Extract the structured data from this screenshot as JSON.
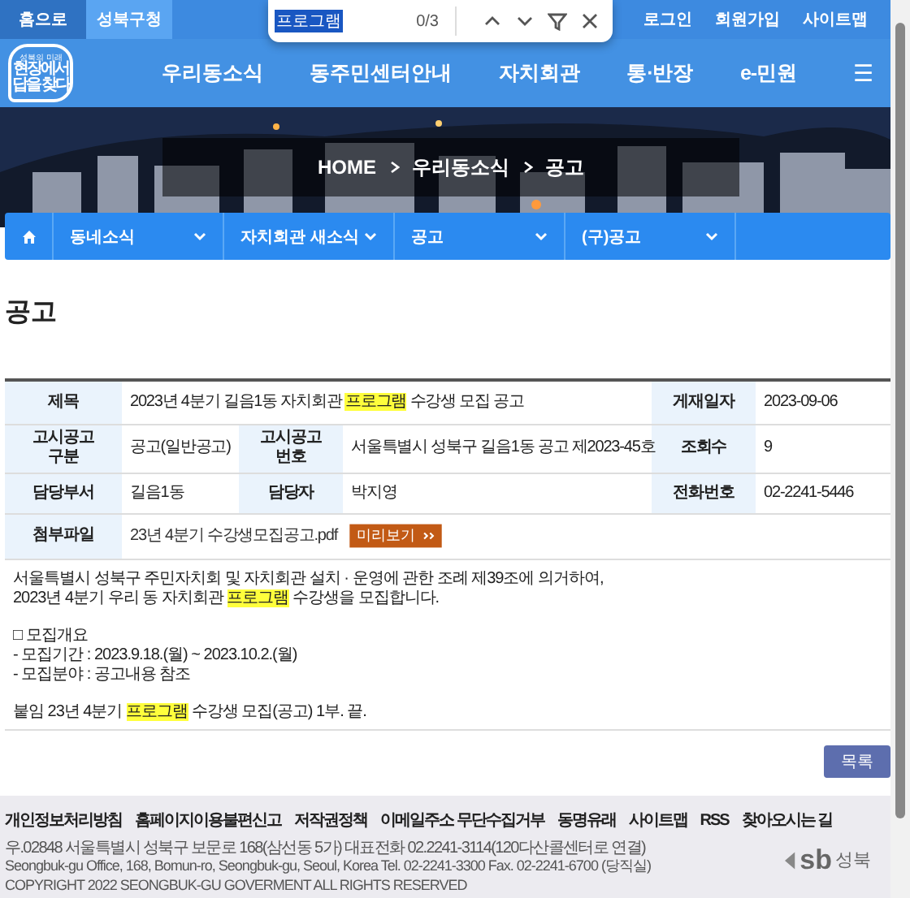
{
  "top_bar": {
    "tabs": [
      {
        "label": "홈으로",
        "selected": true
      },
      {
        "label": "성북구청",
        "selected": false
      }
    ],
    "user_links": [
      "로그인",
      "회원가입",
      "사이트맵"
    ]
  },
  "find_bar": {
    "value": "프로그램",
    "count": "0/3"
  },
  "header": {
    "logo": {
      "tagline": "성북의 미래",
      "lines": [
        "현장에서",
        "답을 찾다"
      ]
    },
    "menu": [
      "우리동소식",
      "동주민센터안내",
      "자치회관",
      "통·반장",
      "e-민원"
    ],
    "menu_icon": "☰"
  },
  "breadcrumb": [
    "HOME",
    "우리동소식",
    "공고"
  ],
  "sub_nav": [
    "동네소식",
    "자치회관 새소식",
    "공고",
    "(구)공고"
  ],
  "page_title": "공고",
  "notice": {
    "rows": [
      {
        "cells": [
          {
            "kind": "label",
            "text": "제목"
          },
          {
            "kind": "value",
            "colspan": 3,
            "segments": [
              {
                "text": "2023년 4분기 길음1동 자치회관 ",
                "highlighted": false
              },
              {
                "text": "프로그램",
                "highlighted": true
              },
              {
                "text": " 수강생 모집 공고",
                "highlighted": false
              }
            ]
          },
          {
            "kind": "label",
            "text": "게재일자"
          },
          {
            "kind": "value",
            "text": "2023-09-06"
          }
        ]
      },
      {
        "cells": [
          {
            "kind": "label",
            "text": "고시공고 구분"
          },
          {
            "kind": "value",
            "text": "공고(일반공고)"
          },
          {
            "kind": "label",
            "text": "고시공고 번호"
          },
          {
            "kind": "value",
            "text": "서울특별시 성북구 길음1동 공고 제2023-45호"
          },
          {
            "kind": "label",
            "text": "조회수"
          },
          {
            "kind": "value",
            "text": "9"
          }
        ]
      },
      {
        "cells": [
          {
            "kind": "label",
            "text": "담당부서"
          },
          {
            "kind": "value",
            "text": "길음1동"
          },
          {
            "kind": "label",
            "text": "담당자"
          },
          {
            "kind": "value",
            "text": "박지영"
          },
          {
            "kind": "label",
            "text": "전화번호"
          },
          {
            "kind": "value",
            "text": "02-2241-5446"
          }
        ]
      },
      {
        "cells": [
          {
            "kind": "label",
            "text": "첨부파일"
          },
          {
            "kind": "file",
            "colspan": 5,
            "text": "23년 4분기 수강생모집공고.pdf",
            "button": "미리보기"
          }
        ]
      }
    ],
    "body": [
      [
        [
          {
            "text": "서울특별시 성북구 주민자치회 및 자치회관 설치 · 운영에 관한 조례 제39조에 의거하여,",
            "highlighted": false
          }
        ],
        [
          {
            "text": "2023년 4분기 우리 동 자치회관 ",
            "highlighted": false
          },
          {
            "text": "프로그램",
            "highlighted": true
          },
          {
            "text": " 수강생을 모집합니다.",
            "highlighted": false
          }
        ]
      ],
      [
        [
          {
            "text": "□ 모집개요",
            "highlighted": false
          }
        ],
        [
          {
            "text": "- 모집기간 : 2023.9.18.(월) ~ 2023.10.2.(월)",
            "highlighted": false
          }
        ],
        [
          {
            "text": "- 모집분야 : 공고내용 참조",
            "highlighted": false
          }
        ]
      ],
      [
        [
          {
            "text": "붙임 23년 4분기 ",
            "highlighted": false
          },
          {
            "text": "프로그램",
            "highlighted": true
          },
          {
            "text": " 수강생 모집(공고) 1부.  끝.",
            "highlighted": false
          }
        ]
      ]
    ],
    "list_button": "목록"
  },
  "footer": {
    "links": [
      "개인정보처리방침",
      "홈페이지이용불편신고",
      "저작권정책",
      "이메일주소 무단수집거부",
      "동명유래",
      "사이트맵",
      "RSS",
      "찾아오시는 길"
    ],
    "address": [
      "우.02848 서울특별시 성북구 보문로 168(삼선동 5가) 대표전화 02.2241-3114(120다산콜센터로 연결)",
      "Seongbuk-gu Office, 168, Bomun-ro, Seongbuk-gu, Seoul, Korea Tel. 02-2241-3300 Fax. 02-2241-6700 (당직실)"
    ],
    "copyright": "COPYRIGHT 2022 SEONGBUK-GU GOVERMENT ALL RIGHTS RESERVED",
    "logo": {
      "mark": "sb",
      "name": "성북"
    }
  }
}
